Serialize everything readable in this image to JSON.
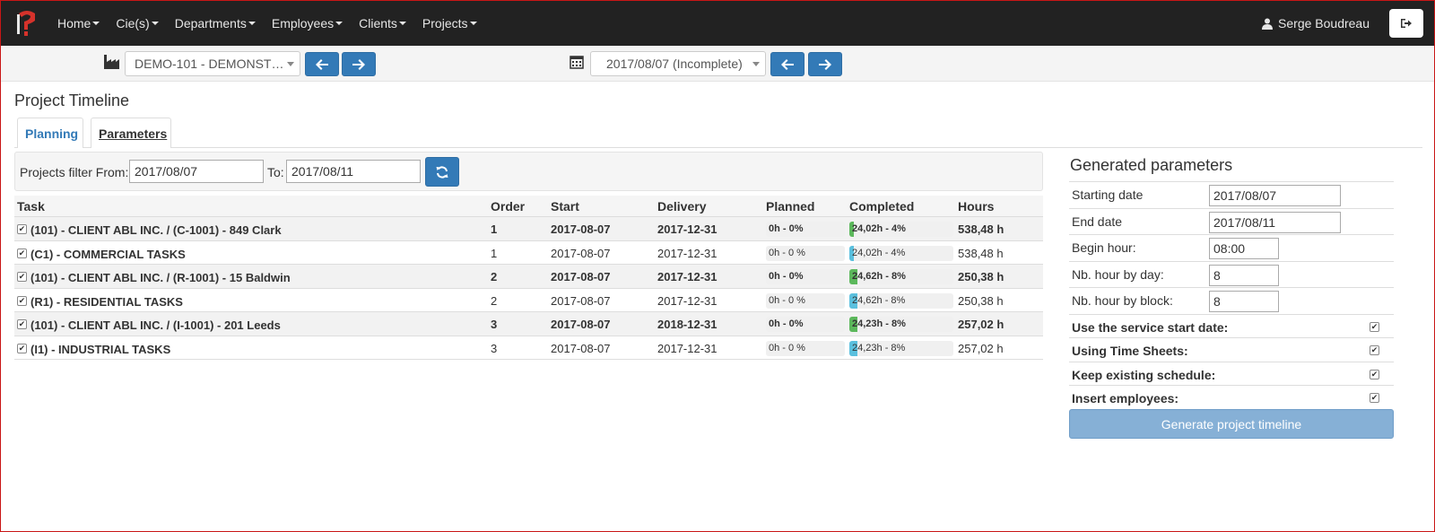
{
  "nav": {
    "items": [
      {
        "label": "Home"
      },
      {
        "label": "Cie(s)"
      },
      {
        "label": "Departments"
      },
      {
        "label": "Employees"
      },
      {
        "label": "Clients"
      },
      {
        "label": "Projects"
      }
    ],
    "user_name": "Serge Boudreau"
  },
  "toolbar": {
    "company_select": "DEMO-101 - DEMONST…",
    "date_select": "2017/08/07 (Incomplete)"
  },
  "page": {
    "title": "Project Timeline",
    "tabs": [
      {
        "label": "Planning",
        "active": true
      },
      {
        "label": "Parameters",
        "active": false
      }
    ]
  },
  "filter": {
    "from_label": "Projects filter From:",
    "from_value": "2017/08/07",
    "to_label": "To:",
    "to_value": "2017/08/11"
  },
  "table": {
    "headers": {
      "task": "Task",
      "order": "Order",
      "start": "Start",
      "delivery": "Delivery",
      "planned": "Planned",
      "completed": "Completed",
      "hours": "Hours"
    },
    "rows": [
      {
        "task": "(101) - CLIENT ABL INC. / (C-1001) - 849 Clark",
        "order": "1",
        "start": "2017-08-07",
        "delivery": "2017-12-31",
        "planned": "0h - 0%",
        "planned_pct": 0,
        "completed": "24,02h - 4%",
        "completed_pct": 4,
        "completed_color": "#5cb85c",
        "hours": "538,48 h",
        "parent": true
      },
      {
        "task": "(C1) - COMMERCIAL TASKS",
        "order": "1",
        "start": "2017-08-07",
        "delivery": "2017-12-31",
        "planned": "0h - 0 %",
        "planned_pct": 0,
        "completed": "24,02h - 4%",
        "completed_pct": 4,
        "completed_color": "#5bc0de",
        "hours": "538,48 h",
        "parent": false
      },
      {
        "task": "(101) - CLIENT ABL INC. / (R-1001) - 15 Baldwin",
        "order": "2",
        "start": "2017-08-07",
        "delivery": "2017-12-31",
        "planned": "0h - 0%",
        "planned_pct": 0,
        "completed": "24,62h - 8%",
        "completed_pct": 8,
        "completed_color": "#5cb85c",
        "hours": "250,38 h",
        "parent": true
      },
      {
        "task": "(R1) - RESIDENTIAL TASKS",
        "order": "2",
        "start": "2017-08-07",
        "delivery": "2017-12-31",
        "planned": "0h - 0 %",
        "planned_pct": 0,
        "completed": "24,62h - 8%",
        "completed_pct": 8,
        "completed_color": "#5bc0de",
        "hours": "250,38 h",
        "parent": false
      },
      {
        "task": "(101) - CLIENT ABL INC. / (I-1001) - 201 Leeds",
        "order": "3",
        "start": "2017-08-07",
        "delivery": "2018-12-31",
        "planned": "0h - 0%",
        "planned_pct": 0,
        "completed": "24,23h - 8%",
        "completed_pct": 8,
        "completed_color": "#5cb85c",
        "hours": "257,02 h",
        "parent": true
      },
      {
        "task": "(I1) - INDUSTRIAL TASKS",
        "order": "3",
        "start": "2017-08-07",
        "delivery": "2017-12-31",
        "planned": "0h - 0 %",
        "planned_pct": 0,
        "completed": "24,23h - 8%",
        "completed_pct": 8,
        "completed_color": "#5bc0de",
        "hours": "257,02 h",
        "parent": false
      }
    ]
  },
  "generated": {
    "title": "Generated parameters",
    "starting_date_label": "Starting date",
    "starting_date": "2017/08/07",
    "end_date_label": "End date",
    "end_date": "2017/08/11",
    "begin_hour_label": "Begin hour:",
    "begin_hour": "08:00",
    "hours_per_day_label": "Nb. hour by day:",
    "hours_per_day": "8",
    "hours_per_block_label": "Nb. hour by block:",
    "hours_per_block": "8",
    "use_service_start_label": "Use the service start date:",
    "using_timesheets_label": "Using Time Sheets:",
    "keep_schedule_label": "Keep existing schedule:",
    "insert_employees_label": "Insert employees:",
    "generate_label": "Generate project timeline"
  }
}
